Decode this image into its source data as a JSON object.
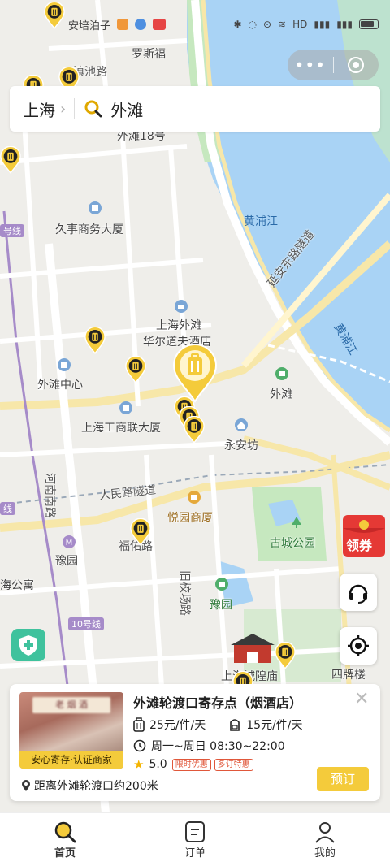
{
  "status_bar": {
    "left_text": "安培泊子",
    "hd": "HD",
    "battery": "◉"
  },
  "capsule": {
    "dots": "•••"
  },
  "search": {
    "city": "上海",
    "chevron": "›",
    "query": "外滩"
  },
  "map": {
    "labels": {
      "luosifu": "罗斯福",
      "dianchi": "滇池路",
      "waitan18": "外滩18号",
      "huangpujiang": "黄浦江",
      "jiushi": "久事商务大厦",
      "yanan": "延安东路隧道",
      "huangpujiang2": "黄浦江",
      "waitan_hotel_1": "上海外滩",
      "waitan_hotel_2": "华尔道夫酒店",
      "waitan_center": "外滩中心",
      "waitan": "外滩",
      "gongshang": "上海工商联大厦",
      "yongan": "永安坊",
      "henan": "河南南路",
      "renmin": "人民路隧道",
      "yuyuan_mansion": "悦园商厦",
      "gucheng": "古城公园",
      "fuyou": "福佑路",
      "yuyuan_station": "豫园",
      "jiuxiao": "旧校场路",
      "yuyuan": "豫园",
      "line10": "10号线",
      "haigong": "海公寓",
      "chenghuang": "上海城隍庙",
      "sipai": "四牌楼",
      "line_label": "号线",
      "line_label2": "线"
    }
  },
  "coupon": {
    "label": "领券"
  },
  "card": {
    "title": "外滩轮渡口寄存点（烟酒店）",
    "photo_sign": "老 烟 酒",
    "badge": "安心寄存·认证商家",
    "price_large": "25元/件/天",
    "price_small": "15元/件/天",
    "hours": "周一~周日 08:30~22:00",
    "rating": "5.0",
    "tag_limited": "限时优惠",
    "tag_multi": "多订特惠",
    "distance": "距离外滩轮渡口约200米",
    "book": "预订",
    "close": "✕"
  },
  "tabs": [
    {
      "label": "首页",
      "icon": "search-icon"
    },
    {
      "label": "订单",
      "icon": "order-icon"
    },
    {
      "label": "我的",
      "icon": "person-icon"
    }
  ],
  "colors": {
    "accent": "#f4cb3b",
    "water": "#a9d3f5",
    "green": "#c6e8bf",
    "road": "#ffffff"
  }
}
